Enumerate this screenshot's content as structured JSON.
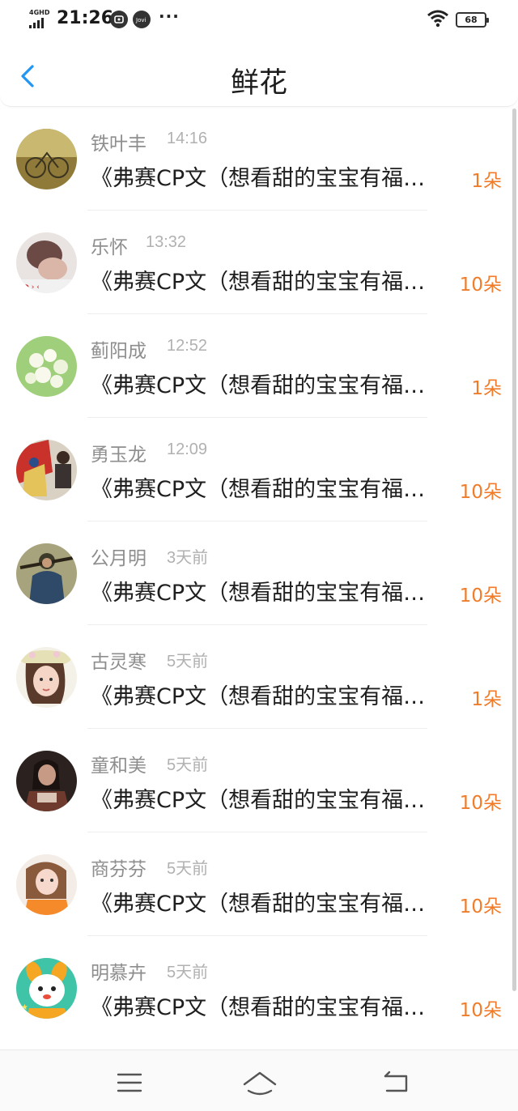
{
  "status_bar": {
    "network": "4GHD",
    "time": "21:26",
    "battery": "68",
    "icons": [
      "message-icon",
      "vivo-icon",
      "more-dots-icon",
      "wifi-icon",
      "battery-icon"
    ]
  },
  "header": {
    "title": "鲜花",
    "back_icon": "chevron-left-icon",
    "accent": "#2196F3"
  },
  "colors": {
    "count": "#F07C2A",
    "name": "#8E8E8E",
    "time": "#B1B1B1"
  },
  "items": [
    {
      "name": "铁叶丰",
      "time": "14:16",
      "message": "《弗赛CP文（想看甜的宝宝有福…",
      "count": "1朵"
    },
    {
      "name": "乐怀",
      "time": "13:32",
      "message": "《弗赛CP文（想看甜的宝宝有福…",
      "count": "10朵"
    },
    {
      "name": "蓟阳成",
      "time": "12:52",
      "message": "《弗赛CP文（想看甜的宝宝有福…",
      "count": "1朵"
    },
    {
      "name": "勇玉龙",
      "time": "12:09",
      "message": "《弗赛CP文（想看甜的宝宝有福…",
      "count": "10朵"
    },
    {
      "name": "公月明",
      "time": "3天前",
      "message": "《弗赛CP文（想看甜的宝宝有福…",
      "count": "10朵"
    },
    {
      "name": "古灵寒",
      "time": "5天前",
      "message": "《弗赛CP文（想看甜的宝宝有福…",
      "count": "1朵"
    },
    {
      "name": "童和美",
      "time": "5天前",
      "message": "《弗赛CP文（想看甜的宝宝有福…",
      "count": "10朵"
    },
    {
      "name": "商芬芬",
      "time": "5天前",
      "message": "《弗赛CP文（想看甜的宝宝有福…",
      "count": "10朵"
    },
    {
      "name": "明慕卉",
      "time": "5天前",
      "message": "《弗赛CP文（想看甜的宝宝有福…",
      "count": "10朵"
    }
  ],
  "nav_bar": {
    "icons": [
      "menu-icon",
      "home-icon",
      "back-icon"
    ]
  }
}
